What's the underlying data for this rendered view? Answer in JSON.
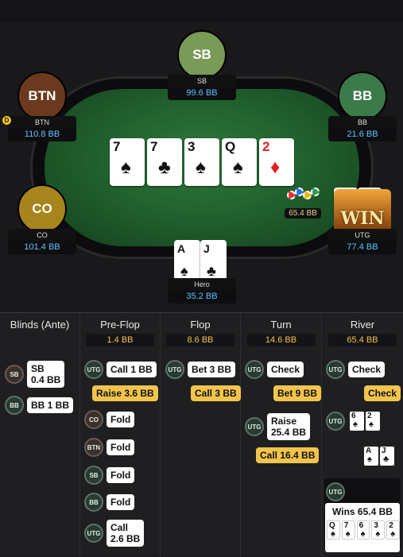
{
  "seats": {
    "sb": {
      "avatar": "SB",
      "name": "SB",
      "stack": "99.6 BB",
      "color": "#7a9a58"
    },
    "btn": {
      "avatar": "BTN",
      "name": "BTN",
      "stack": "110.8 BB",
      "color": "#6b3a1e"
    },
    "bb": {
      "avatar": "BB",
      "name": "BB",
      "stack": "21.6 BB",
      "color": "#3d7a4a"
    },
    "co": {
      "avatar": "CO",
      "name": "CO",
      "stack": "101.4 BB",
      "color": "#a7841c"
    },
    "utg": {
      "name": "UTG",
      "stack": "77.4 BB"
    },
    "hero": {
      "name": "Hero",
      "stack": "35.2 BB"
    }
  },
  "dealer_button": "D",
  "board": [
    {
      "rank": "7",
      "suit": "♠",
      "color": "black"
    },
    {
      "rank": "7",
      "suit": "♣",
      "color": "black"
    },
    {
      "rank": "3",
      "suit": "♠",
      "color": "black"
    },
    {
      "rank": "Q",
      "suit": "♠",
      "color": "black"
    },
    {
      "rank": "2",
      "suit": "♦",
      "color": "red"
    }
  ],
  "hero_cards": [
    {
      "rank": "A",
      "suit": "♠"
    },
    {
      "rank": "J",
      "suit": "♣"
    }
  ],
  "utg_cards": [
    {
      "rank": "6",
      "suit": "♠"
    },
    {
      "rank": "2",
      "suit": "♠"
    }
  ],
  "pot": "65.4 BB",
  "win_text": "WIN",
  "columns": [
    {
      "title": "Blinds (Ante)",
      "pot": ""
    },
    {
      "title": "Pre-Flop",
      "pot": "1.4 BB"
    },
    {
      "title": "Flop",
      "pot": "8.6 BB"
    },
    {
      "title": "Turn",
      "pot": "14.6 BB"
    },
    {
      "title": "River",
      "pot": "65.4 BB"
    }
  ],
  "actions": {
    "blinds": [
      {
        "pos": "SB",
        "text": "SB\n0.4 BB"
      },
      {
        "pos": "BB",
        "text": "BB 1 BB"
      }
    ],
    "preflop": [
      {
        "pos": "UTG",
        "text": "Call 1 BB"
      },
      {
        "pos": "",
        "text": "Raise 3.6 BB"
      },
      {
        "pos": "CO",
        "text": "Fold"
      },
      {
        "pos": "BTN",
        "text": "Fold"
      },
      {
        "pos": "SB",
        "text": "Fold"
      },
      {
        "pos": "BB",
        "text": "Fold"
      },
      {
        "pos": "UTG",
        "text": "Call\n2.6 BB"
      }
    ],
    "flop": [
      {
        "pos": "UTG",
        "text": "Bet 3 BB"
      },
      {
        "pos": "",
        "text": "Call 3 BB"
      }
    ],
    "turn": [
      {
        "pos": "UTG",
        "text": "Check"
      },
      {
        "pos": "",
        "text": "Bet 9 BB"
      },
      {
        "pos": "UTG",
        "text": "Raise\n25.4 BB"
      },
      {
        "pos": "",
        "text": "Call 16.4 BB"
      }
    ],
    "river": [
      {
        "pos": "UTG",
        "text": "Check"
      },
      {
        "pos": "",
        "text": "Check"
      },
      {
        "pos": "UTG",
        "text": ""
      }
    ]
  },
  "river_show_utg": [
    {
      "rank": "6",
      "suit": "♠"
    },
    {
      "rank": "2",
      "suit": "♠"
    }
  ],
  "river_show_hero": [
    {
      "rank": "A",
      "suit": "♠"
    },
    {
      "rank": "J",
      "suit": "♣"
    }
  ],
  "wins": {
    "pos": "UTG",
    "label": "Wins 65.4 BB",
    "cards": [
      {
        "rank": "Q",
        "suit": "♠"
      },
      {
        "rank": "7",
        "suit": "♠"
      },
      {
        "rank": "6",
        "suit": "♠"
      },
      {
        "rank": "3",
        "suit": "♠"
      },
      {
        "rank": "2",
        "suit": "♠"
      }
    ]
  }
}
